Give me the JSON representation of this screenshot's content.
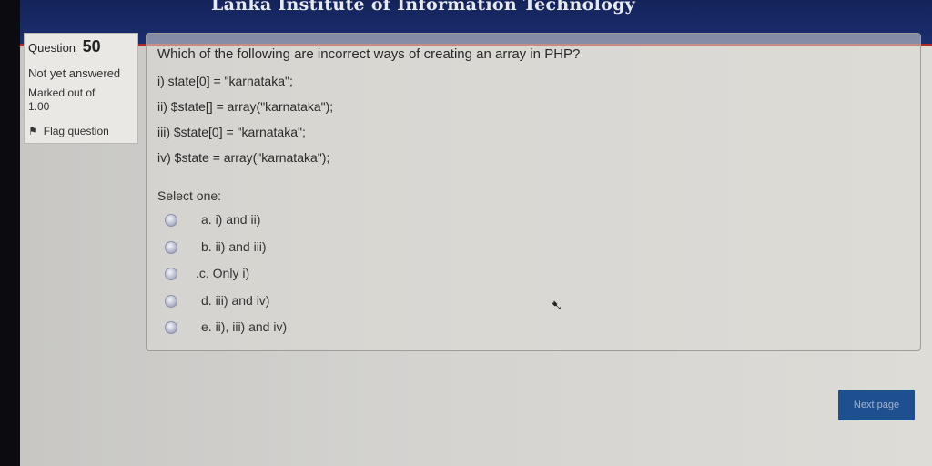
{
  "header": {
    "title": "Lanka Institute of Information Technology"
  },
  "question_info": {
    "label": "Question",
    "number": "50",
    "state": "Not yet answered",
    "marked_line1": "Marked out of",
    "marked_line2": "1.00",
    "flag_label": "Flag question"
  },
  "question": {
    "text": "Which of the following are incorrect ways of creating an array in PHP?",
    "lines": [
      "i) state[0] = \"karnataka\";",
      "ii) $state[] = array(\"karnataka\");",
      "iii) $state[0] = \"karnataka\";",
      "iv)  $state = array(\"karnataka\");"
    ],
    "select_label": "Select one:",
    "options": [
      "a. i) and ii)",
      "b. ii) and iii)",
      ".c. Only i)",
      "d. iii) and iv)",
      "e. ii), iii) and iv)"
    ]
  },
  "navigation": {
    "next_label": "Next page"
  }
}
